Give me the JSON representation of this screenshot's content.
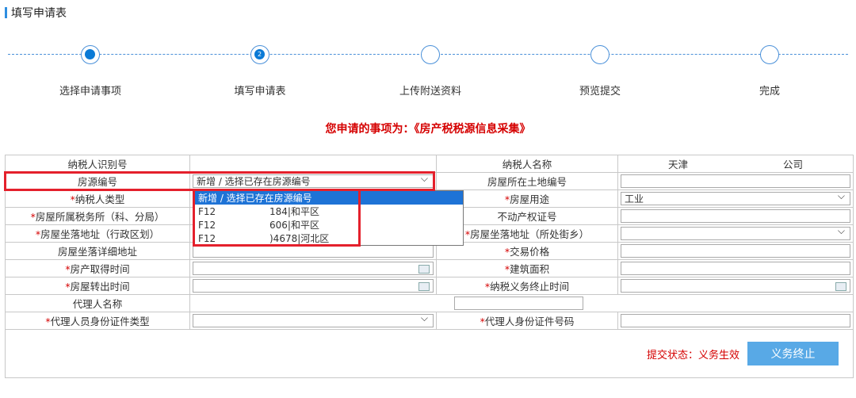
{
  "section": {
    "title": "填写申请表"
  },
  "steps": [
    {
      "label": "选择申请事项",
      "state": "done"
    },
    {
      "label": "填写申请表",
      "state": "current",
      "num": "2"
    },
    {
      "label": "上传附送资料",
      "state": "todo"
    },
    {
      "label": "预览提交",
      "state": "todo"
    },
    {
      "label": "完成",
      "state": "todo"
    }
  ],
  "headline": "您申请的事项为：《房产税税源信息采集》",
  "form": {
    "taxpayer_id_label": "纳税人识别号",
    "taxpayer_name_label": "纳税人名称",
    "taxpayer_name_part1": "天津",
    "taxpayer_name_part2": "公司",
    "house_no_label": "房源编号",
    "house_no_value": "新增 / 选择已存在房源编号",
    "land_no_label": "房屋所在土地编号",
    "taxpayer_type_label": "纳税人类型",
    "house_use_label": "房屋用途",
    "house_use_value": "工业",
    "tax_office_label": "房屋所属税务所（科、分局）",
    "property_cert_label": "不动产权证号",
    "addr_district_label": "房屋坐落地址（行政区划）",
    "addr_street_label": "房屋坐落地址（所处街乡）",
    "addr_detail_label": "房屋坐落详细地址",
    "trade_price_label": "交易价格",
    "acquire_time_label": "房产取得时间",
    "area_label": "建筑面积",
    "transfer_time_label": "房屋转出时间",
    "duty_end_label": "纳税义务终止时间",
    "agent_name_label": "代理人名称",
    "agent_id_type_label": "代理人员身份证件类型",
    "agent_id_no_label": "代理人身份证件号码"
  },
  "dropdown": {
    "options": [
      {
        "code": "新增 / 选择已存在房源编号",
        "addr": ""
      },
      {
        "code": "F12",
        "addr": "184|和平区"
      },
      {
        "code": "F12",
        "addr": "606|和平区"
      },
      {
        "code": "F12",
        "addr": ")4678|河北区"
      }
    ]
  },
  "footer": {
    "status": "提交状态：义务生效",
    "terminate_button": "义务终止"
  },
  "colors": {
    "accent": "#0a7ad6",
    "required": "#d50000",
    "button": "#58a9e6",
    "highlight": "#e4202c"
  }
}
